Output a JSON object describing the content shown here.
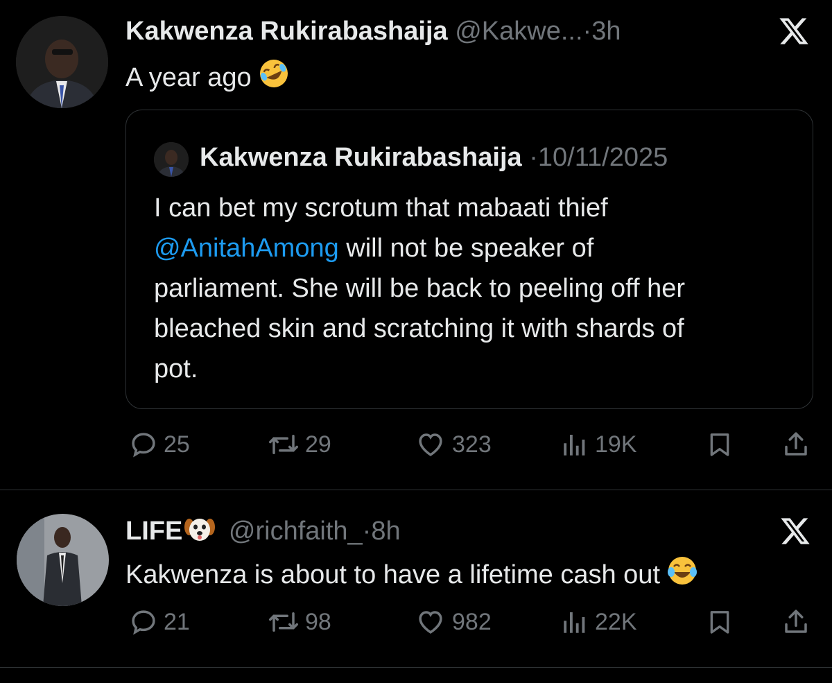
{
  "tweets": [
    {
      "author_name": "Kakwenza Rukirabashaija",
      "handle": "@Kakwe...",
      "separator": "·",
      "time": "3h",
      "text": "A year ago",
      "text_emoji": "rolling-on-floor-laughing",
      "quote": {
        "author_name": "Kakwenza Rukirabashaija",
        "separator": "·",
        "date": "10/11/2025",
        "lines": [
          {
            "before": "I can bet my scrotum that mabaati thief",
            "mention": "",
            "after": ""
          },
          {
            "before": "",
            "mention": "@AnitahAmong",
            "after": " will not be speaker of"
          },
          {
            "before": "parliament. She will be back to peeling off her",
            "mention": "",
            "after": ""
          },
          {
            "before": "bleached skin and scratching it with shards of",
            "mention": "",
            "after": ""
          },
          {
            "before": "pot.",
            "mention": "",
            "after": ""
          }
        ]
      },
      "stats": {
        "replies": "25",
        "reposts": "29",
        "likes": "323",
        "views": "19K"
      }
    },
    {
      "author_name": "LIFE",
      "author_emoji": "dog-face",
      "handle": "@richfaith_",
      "separator": "·",
      "time": "8h",
      "text": "Kakwenza is about to have a lifetime cash out",
      "text_emoji": "face-with-tears-of-joy",
      "stats": {
        "replies": "21",
        "reposts": "98",
        "likes": "982",
        "views": "22K"
      }
    }
  ],
  "colors": {
    "background": "#000000",
    "primary_text": "#e7e9ea",
    "secondary_text": "#71767b",
    "link": "#1d9bf0",
    "border": "#2f3336"
  },
  "icons": [
    "x-logo-icon",
    "reply-icon",
    "repost-icon",
    "like-icon",
    "views-icon",
    "bookmark-icon",
    "share-icon"
  ]
}
